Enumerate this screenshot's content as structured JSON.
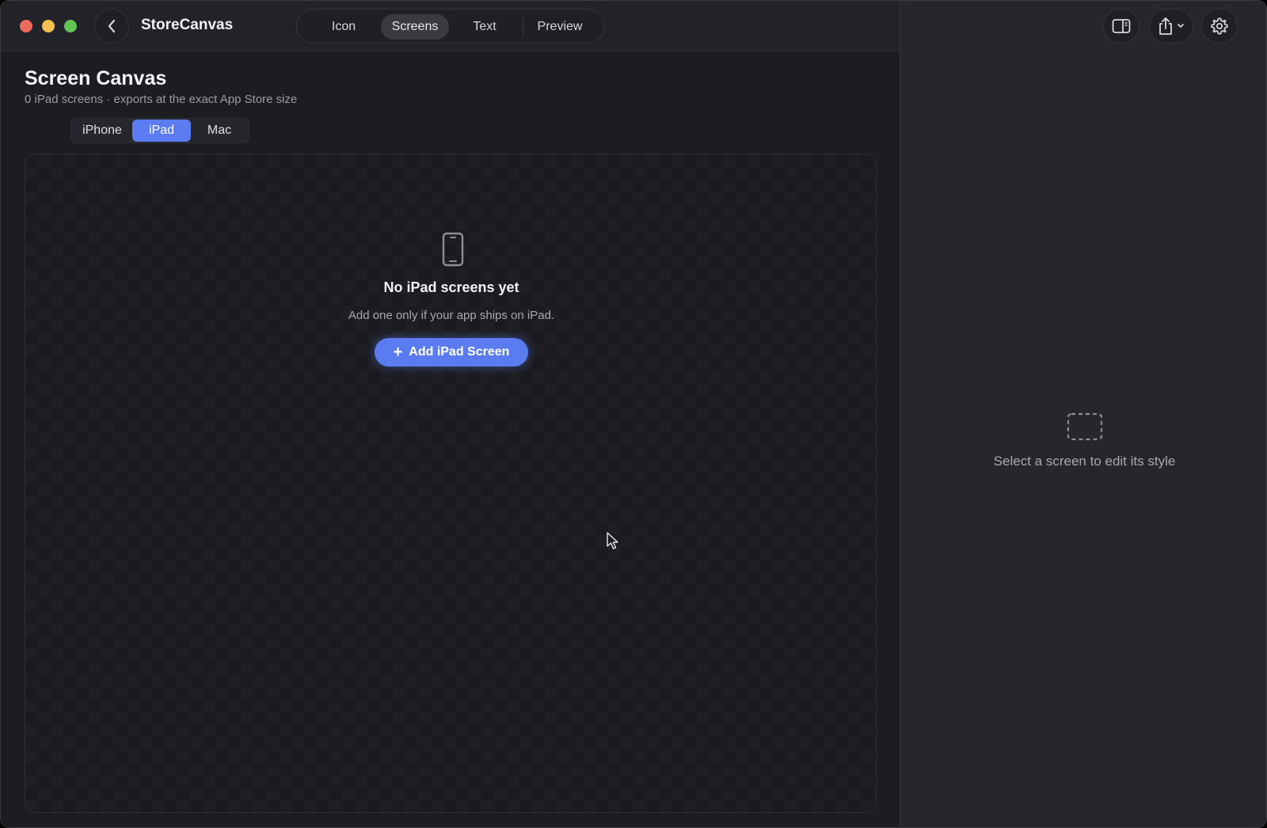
{
  "window": {
    "app_title": "StoreCanvas"
  },
  "main_tabs": [
    {
      "label": "Icon",
      "active": false
    },
    {
      "label": "Screens",
      "active": true
    },
    {
      "label": "Text",
      "active": false
    },
    {
      "label": "Preview",
      "active": false
    }
  ],
  "page": {
    "title": "Screen Canvas",
    "subtitle": "0 iPad screens · exports at the exact App Store size"
  },
  "device_tabs": [
    {
      "label": "iPhone",
      "active": false
    },
    {
      "label": "iPad",
      "active": true
    },
    {
      "label": "Mac",
      "active": false
    }
  ],
  "empty_state": {
    "icon": "phone-icon",
    "title": "No iPad screens yet",
    "subtitle": "Add one only if your app ships on iPad.",
    "button_label": "Add iPad Screen"
  },
  "inspector": {
    "placeholder_icon": "dashed-rect-icon",
    "placeholder_text": "Select a screen to edit its style"
  },
  "toolbar_icons": [
    "back-chevron-icon",
    "sidebar-toggle-icon",
    "share-icon",
    "gear-icon"
  ],
  "colors": {
    "accent": "#5b7cf0",
    "window_bg": "#1c1d21",
    "panel_bg": "#26272c"
  }
}
